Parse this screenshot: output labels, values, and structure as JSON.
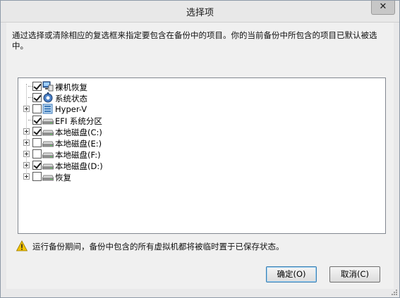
{
  "window": {
    "title": "选择项",
    "close_glyph": "✕"
  },
  "description": "通过选择或清除相应的复选框来指定要包含在备份中的项目。你的当前备份中所包含的项目已默认被选中。",
  "tree": {
    "items": [
      {
        "label": "裸机恢复",
        "checked": true,
        "expandable": false,
        "icon": "bare-metal-icon"
      },
      {
        "label": "系统状态",
        "checked": true,
        "expandable": false,
        "icon": "system-state-icon"
      },
      {
        "label": "Hyper-V",
        "checked": false,
        "expandable": true,
        "icon": "hyperv-icon"
      },
      {
        "label": "EFI 系统分区",
        "checked": true,
        "expandable": false,
        "icon": "drive-icon"
      },
      {
        "label": "本地磁盘(C:)",
        "checked": true,
        "expandable": true,
        "icon": "drive-icon"
      },
      {
        "label": "本地磁盘(E:)",
        "checked": false,
        "expandable": true,
        "icon": "drive-icon"
      },
      {
        "label": "本地磁盘(F:)",
        "checked": false,
        "expandable": true,
        "icon": "drive-icon"
      },
      {
        "label": "本地磁盘(D:)",
        "checked": true,
        "expandable": true,
        "icon": "drive-icon"
      },
      {
        "label": "恢复",
        "checked": false,
        "expandable": true,
        "icon": "drive-icon"
      }
    ]
  },
  "warning": "运行备份期间，备份中包含的所有虚拟机都将被临时置于已保存状态。",
  "buttons": {
    "ok": "确定(O)",
    "cancel": "取消(C)"
  },
  "colors": {
    "accent": "#3c7fb1",
    "warning": "#f2c200"
  }
}
